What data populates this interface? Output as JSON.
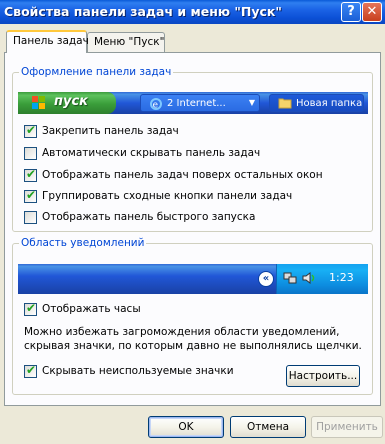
{
  "window": {
    "title": "Свойства панели задач и меню \"Пуск\"",
    "help_label": "?",
    "close_label": "✕"
  },
  "tabs": [
    {
      "label": "Панель задач",
      "active": true
    },
    {
      "label": "Меню \"Пуск\"",
      "active": false
    }
  ],
  "taskbar_group": {
    "label": "Оформление панели задач",
    "preview": {
      "start_label": "пуск",
      "items": [
        {
          "label": "2 Internet...",
          "icon": "ie-icon"
        },
        {
          "label": "Новая папка",
          "icon": "folder-icon"
        }
      ]
    },
    "options": [
      {
        "label": "Закрепить панель задач",
        "checked": true
      },
      {
        "label": "Автоматически скрывать панель задач",
        "checked": false
      },
      {
        "label": "Отображать панель задач поверх остальных окон",
        "checked": true
      },
      {
        "label": "Группировать сходные кнопки панели задач",
        "checked": true
      },
      {
        "label": "Отображать панель быстрого запуска",
        "checked": false
      }
    ]
  },
  "tray_group": {
    "label": "Область уведомлений",
    "preview": {
      "chevron": "«",
      "clock": "1:23"
    },
    "show_clock": {
      "label": "Отображать часы",
      "checked": true
    },
    "description": "Можно избежать загромождения области уведомлений, скрывая значки, по которым давно не выполнялись щелчки.",
    "hide_inactive": {
      "label": "Скрывать неиспользуемые значки",
      "checked": true
    },
    "customize_label": "Настроить..."
  },
  "buttons": {
    "ok": "OK",
    "cancel": "Отмена",
    "apply": "Применить"
  },
  "colors": {
    "titlebar": "#0a5ad8",
    "group_label": "#0046d5",
    "start_button": "#3c9b3c",
    "check": "#21a121"
  }
}
